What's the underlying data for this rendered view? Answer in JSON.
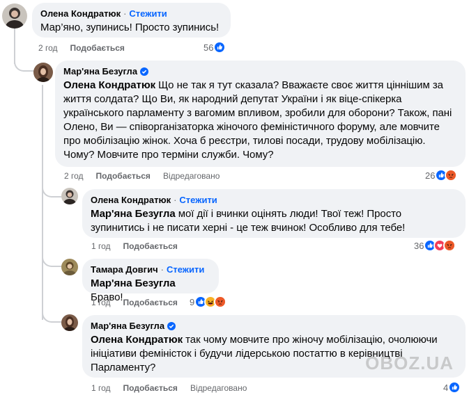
{
  "colors": {
    "accent": "#0866ff",
    "bubble": "#f0f2f5",
    "meta": "#65676b",
    "thread": "#ced0d4"
  },
  "comments": [
    {
      "author": "Олена Кондратюк",
      "separator": "·",
      "follow": "Стежити",
      "text": "Мар’яно, зупинись! Просто зупинись!",
      "time": "2 год",
      "like": "Подобається",
      "reaction_count": "56",
      "reactions": [
        "like-reaction-icon"
      ]
    },
    {
      "author": "Мар'яна Безугла",
      "verified": "verified-badge-icon",
      "tag": "Олена Кондратюк",
      "text": " Що не так я тут сказала? Вважаєте своє життя ціннішим за життя солдата? Що Ви, як народний депутат України і як віце-спікерка українського парламенту з вагомим впливом, зробили для оборони? Також, пані Олено, Ви — співорганізаторка жіночого феміністичного форуму, але мовчите про мобілізацію жінок. Хоча б реєстри, тилові посади, трудову мобілізацію. Чому? Мовчите про терміни служби. Чому?",
      "time": "2 год",
      "like": "Подобається",
      "edited": "Відредаговано",
      "reaction_count": "26",
      "reactions": [
        "like-reaction-icon",
        "angry-reaction-icon"
      ]
    },
    {
      "author": "Олена Кондратюк",
      "separator": "·",
      "follow": "Стежити",
      "tag": "Мар'яна Безугла",
      "text": " мої дії і вчинки оцінять люди! Твої теж! Просто зупинитись і не писати херні - це теж вчинок! Особливо для тебе!",
      "time": "1 год",
      "like": "Подобається",
      "reaction_count": "36",
      "reactions": [
        "like-reaction-icon",
        "love-reaction-icon",
        "angry-reaction-icon"
      ]
    },
    {
      "author": "Тамара Довгич",
      "separator": "·",
      "follow": "Стежити",
      "tag": "Мар'яна Безугла",
      "text": " Браво!",
      "time": "1 год",
      "like": "Подобається",
      "reaction_count": "9",
      "reactions": [
        "like-reaction-icon",
        "haha-reaction-icon",
        "angry-reaction-icon"
      ]
    },
    {
      "author": "Мар'яна Безугла",
      "verified": "verified-badge-icon",
      "tag": "Олена Кондратюк",
      "text": " так чому мовчите про жіночу мобілізацію, очолюючи ініціативи феміністок і будучи лідерською постаттю в керівництві Парламенту?",
      "time": "1 год",
      "like": "Подобається",
      "edited": "Відредаговано",
      "reaction_count": "4",
      "reactions": [
        "like-reaction-icon"
      ]
    }
  ],
  "watermark": "OBOZ.UA"
}
